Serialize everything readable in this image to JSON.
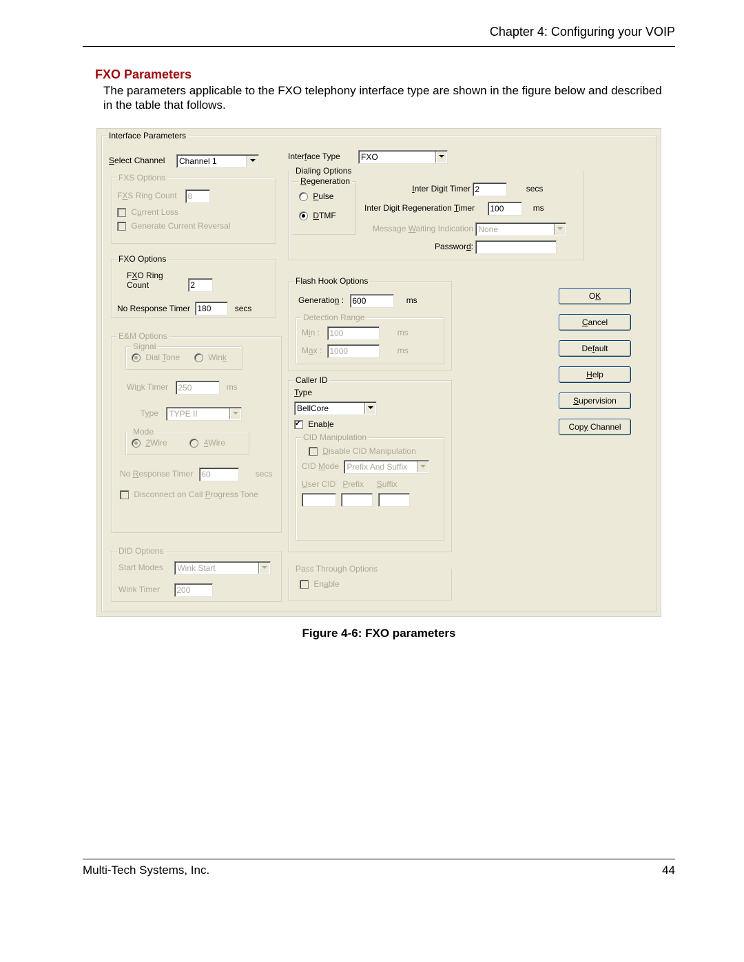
{
  "chapter_header": "Chapter 4: Configuring your VOIP",
  "section_title": "FXO Parameters",
  "intro": "The parameters applicable to the FXO telephony interface type are shown in the figure below and described in the table that follows.",
  "panel_title": "Interface Parameters",
  "select_channel_label": "Select Channel",
  "select_channel_value": "Channel 1",
  "interface_type_label": "Interface Type",
  "interface_type_value": "FXO",
  "fxs": {
    "legend": "FXS Options",
    "ring_count_label": "FXS Ring Count",
    "ring_count_value": "8",
    "current_loss_label": "Current  Loss",
    "gen_rev_label": "Generate Current Reversal"
  },
  "fxo": {
    "legend": "FXO Options",
    "ring_count_label": "FXO Ring Count",
    "ring_count_value": "2",
    "nrt_label": "No Response Timer",
    "nrt_value": "180",
    "nrt_unit": "secs"
  },
  "em": {
    "legend": "E&M Options",
    "signal_legend": "Signal",
    "dialtone": "Dial Tone",
    "wink": "Wink",
    "wink_timer_label": "Wink Timer",
    "wink_timer_value": "250",
    "wink_timer_unit": "ms",
    "type_label": "Type",
    "type_value": "TYPE II",
    "mode_legend": "Mode",
    "mode_2w": "2Wire",
    "mode_4w": "4Wire",
    "nrt_label": "No Response Timer",
    "nrt_value": "60",
    "nrt_unit": "secs",
    "disc_label": "Disconnect on Call Progress Tone"
  },
  "did": {
    "legend": "DID Options",
    "start_modes_label": "Start Modes",
    "start_modes_value": "Wink Start",
    "wink_timer_label": "Wink Timer",
    "wink_timer_value": "200"
  },
  "dialing": {
    "legend": "Dialing Options",
    "regen_legend": "Regeneration",
    "pulse": "Pulse",
    "dtmf": "DTMF",
    "idt_label": "Inter Digit Timer",
    "idt_value": "2",
    "idt_unit": "secs",
    "idrt_label": "Inter Digit Regeneration Timer",
    "idrt_value": "100",
    "idrt_unit": "ms",
    "mwi_label": "Message Waiting Indication",
    "mwi_value": "None",
    "pwd_label": "Password:"
  },
  "flash": {
    "legend": "Flash Hook Options",
    "gen_label": "Generation :",
    "gen_value": "600",
    "gen_unit": "ms",
    "range_legend": "Detection Range",
    "min_label": "Min :",
    "min_value": "100",
    "min_unit": "ms",
    "max_label": "Max :",
    "max_value": "1000",
    "max_unit": "ms"
  },
  "cid": {
    "legend": "Caller ID",
    "type_label": "Type",
    "type_value": "BellCore",
    "enable_label": "Enable",
    "manip_legend": "CID Manipulation",
    "disable_label": "Disable CID Manipulation",
    "mode_label": "CID Mode",
    "mode_value": "Prefix And Suffix",
    "user_label": "User CID",
    "prefix_label": "Prefix",
    "suffix_label": "Suffix"
  },
  "pass": {
    "legend": "Pass Through Options",
    "enable_label": "Enable"
  },
  "buttons": {
    "ok": "OK",
    "cancel": "Cancel",
    "default": "Default",
    "help": "Help",
    "supervision": "Supervision",
    "copy": "Copy Channel"
  },
  "caption": "Figure 4-6: FXO parameters",
  "footer_left": "Multi-Tech Systems, Inc.",
  "footer_right": "44"
}
